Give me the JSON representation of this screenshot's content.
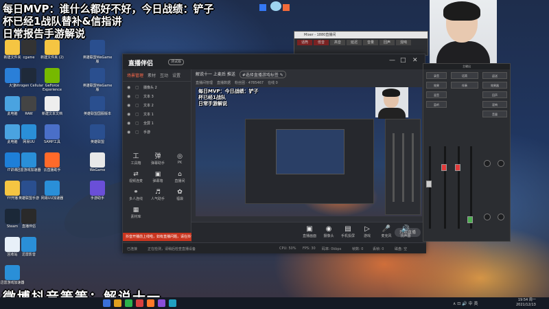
{
  "overlay": {
    "line1": "每日MVP：谁什么都好不好，今日战绩：铲子",
    "line2": "杯已经1战队替补&信指讲",
    "line3": "日常报告手游解说",
    "bottom": "微博抖音等等：解说十一"
  },
  "desktop_icons": [
    {
      "label": "新建文件夹"
    },
    {
      "label": "cgame"
    },
    {
      "label": "新建文件夹 (2)"
    },
    {
      "label": "英雄联盟WeGame版"
    },
    {
      "label": "大宝"
    },
    {
      "label": "Nitrogen Cellular"
    },
    {
      "label": "GeForce Experience"
    },
    {
      "label": "英雄联盟WeGame版"
    },
    {
      "label": "此电脑"
    },
    {
      "label": "RAW"
    },
    {
      "label": "新建文本文档"
    },
    {
      "label": "英雄联盟国服版本"
    },
    {
      "label": "此电脑"
    },
    {
      "label": "网易UU"
    },
    {
      "label": "SAMP工具"
    },
    {
      "label": "英雄联盟"
    },
    {
      "label": "IT讲课"
    },
    {
      "label": "迅雷游戏加速器"
    },
    {
      "label": "云直播助手"
    },
    {
      "label": "WeGame"
    },
    {
      "label": "YY开播"
    },
    {
      "label": "英雄联盟手游"
    },
    {
      "label": "网易UU加速器"
    },
    {
      "label": "手游助手"
    },
    {
      "label": "Steam"
    },
    {
      "label": "直播伴侣"
    },
    {
      "label": "回收站"
    },
    {
      "label": "迅雷影音"
    },
    {
      "label": "迅雷游戏加速器"
    }
  ],
  "mini_window": {
    "title": "Mixer - 1880直播间",
    "cells": [
      "话筒",
      "低音",
      "高音",
      "延迟",
      "音量",
      "回声",
      "混响"
    ]
  },
  "app": {
    "logo": "直播伴侣",
    "badge": "测试版",
    "win_controls": [
      "—",
      "□",
      "✕"
    ],
    "side_tabs": [
      "场景管理",
      "素材",
      "互动",
      "设置"
    ],
    "scenes": [
      {
        "name": "摄像头 2"
      },
      {
        "name": "文本 3"
      },
      {
        "name": "文本 2"
      },
      {
        "name": "文本 1"
      },
      {
        "name": "全屏 1"
      },
      {
        "name": "手游"
      }
    ],
    "tools": [
      {
        "label": "工具箱",
        "icon": "工"
      },
      {
        "label": "弹幕助手",
        "icon": "弹"
      },
      {
        "label": "PK",
        "icon": "◎"
      },
      {
        "label": "视频连麦",
        "icon": "⇄"
      },
      {
        "label": "弹幕墙",
        "icon": "▣"
      },
      {
        "label": "直播间",
        "icon": "⌂"
      },
      {
        "label": "多人连线",
        "icon": "⚭"
      },
      {
        "label": "人气助手",
        "icon": "♬"
      },
      {
        "label": "福袋",
        "icon": "✿"
      },
      {
        "label": "素材库",
        "icon": "▦"
      }
    ],
    "notice": "抖音开播前上线啦，如有直播问题，请在抖音后台反馈",
    "preview_title": "解说十一 上麦后 推送",
    "preview_pill": "#选择直播游戏标签 ✎",
    "preview_sub": [
      "直播间管理",
      "直播数据",
      "粉丝团 · 4785467",
      "在线 0"
    ],
    "preview_overlay": [
      "每日MVP：今日战绩：铲子",
      "杯已经1战队",
      "日常手游解说"
    ],
    "bottom_buttons": [
      {
        "label": "直播画面",
        "icon": "▣"
      },
      {
        "label": "摄像头",
        "icon": "◉"
      },
      {
        "label": "手机投屏",
        "icon": "▤"
      },
      {
        "label": "游戏",
        "icon": "▷"
      },
      {
        "label": "麦克风",
        "icon": "🎤"
      },
      {
        "label": "扬声器",
        "icon": "🔊"
      }
    ],
    "start_label": "开始直播",
    "status_left": "已连接",
    "status_msg": "正在检测，请稍后检查直播设备",
    "status_vals": [
      "CPU: 50%",
      "FPS: 30",
      "码率: 0kbps",
      "帧数: 0",
      "丢帧: 0",
      "磁盘: 空"
    ]
  },
  "mixer": {
    "title": "主输出",
    "boxes": [
      "录音",
      "效果",
      "混音",
      "监听",
      "话筒",
      "伴奏",
      "返送",
      "效果器",
      "回声",
      "混响",
      "音量"
    ]
  },
  "taskbar": {
    "time": "19:54 周一",
    "date": "2021/12/13",
    "tray": "∧ ⊡ 🔊 中 英"
  },
  "colors": {
    "accent_red": "#e23b3b",
    "notice_red": "#c9351f",
    "app_bg": "#26282d"
  }
}
